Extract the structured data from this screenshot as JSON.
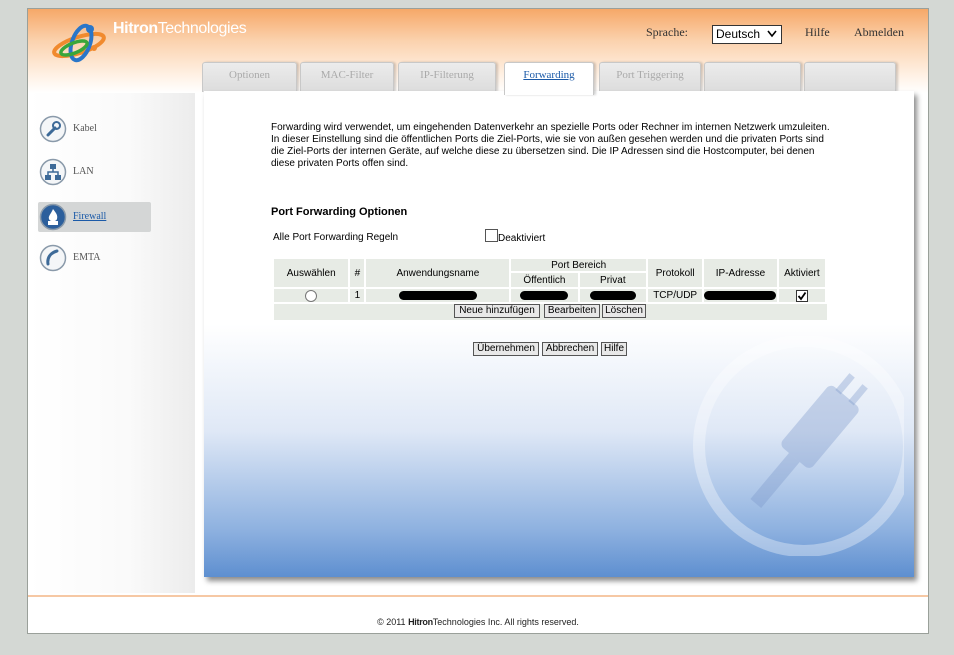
{
  "header": {
    "brand_bold": "Hitron",
    "brand_thin": "Technologies",
    "language_label": "Sprache:",
    "language_value": "Deutsch",
    "help_link": "Hilfe",
    "logout_link": "Abmelden"
  },
  "tabs": [
    {
      "label": "Optionen",
      "active": false
    },
    {
      "label": "MAC-Filter",
      "active": false
    },
    {
      "label": "IP-Filterung",
      "active": false
    },
    {
      "label": "Forwarding",
      "active": true
    },
    {
      "label": "Port Triggering",
      "active": false
    },
    {
      "label": "",
      "active": false
    },
    {
      "label": "",
      "active": false
    }
  ],
  "sidebar": {
    "items": [
      {
        "label": "Kabel",
        "icon": "wrench-icon",
        "active": false
      },
      {
        "label": "LAN",
        "icon": "network-icon",
        "active": false
      },
      {
        "label": "Firewall",
        "icon": "firewall-icon",
        "active": true
      },
      {
        "label": "EMTA",
        "icon": "phone-icon",
        "active": false
      }
    ]
  },
  "main": {
    "intro": "Forwarding wird verwendet, um eingehenden Datenverkehr an spezielle Ports oder Rechner im internen Netzwerk umzuleiten. In dieser Einstellung sind die öffentlichen Ports die Ziel-Ports, wie sie von außen gesehen werden und die privaten Ports sind die Ziel-Ports der internen Geräte, auf welche diese zu übersetzen sind. Die IP Adressen sind die Hostcomputer, bei denen diese privaten Ports offen sind.",
    "section_title": "Port Forwarding Optionen",
    "all_rules_label": "Alle Port Forwarding Regeln",
    "disabled_label": "Deaktiviert",
    "disabled_checked": false,
    "table": {
      "headers": {
        "select": "Auswählen",
        "num": "#",
        "app_name": "Anwendungsname",
        "port_range": "Port Bereich",
        "public": "Öffentlich",
        "private": "Privat",
        "protocol": "Protokoll",
        "ip": "IP-Adresse",
        "active": "Aktiviert"
      },
      "rows": [
        {
          "num": "1",
          "protocol": "TCP/UDP",
          "active": true
        }
      ]
    },
    "buttons": {
      "add": "Neue hinzufügen",
      "edit": "Bearbeiten",
      "delete": "Löschen",
      "apply": "Übernehmen",
      "cancel": "Abbrechen",
      "help": "Hilfe"
    }
  },
  "footer": {
    "prefix": "© 2011",
    "brand_bold": "Hitron",
    "brand_thin": "Technologies",
    "suffix": "Inc.  All rights reserved."
  },
  "colors": {
    "header_orange": "#f6a868",
    "link_blue": "#1b5aa8",
    "content_blue": "#5e8fd0",
    "table_cell": "#e7ebe5"
  }
}
